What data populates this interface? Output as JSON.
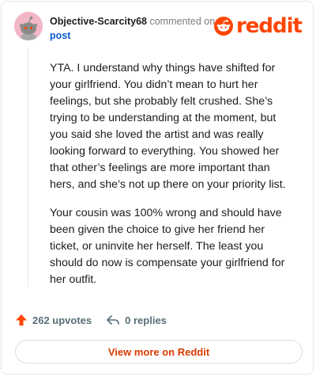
{
  "comment": {
    "username": "Objective-Scarcity68",
    "commented_on": "commented on",
    "post_link": "post",
    "paragraphs": [
      "YTA. I understand why things have shifted for your girlfriend. You didn’t mean to hurt her feelings, but she probably felt crushed. She’s trying to be understanding at the moment, but you said she loved the artist and was really looking forward to everything. You showed her that other’s feelings are more important than hers, and she’s not up there on your priority list.",
      "Your cousin was 100% wrong and should have been given the choice to give her friend her ticket, or uninvite her herself. The least you should do now is compensate your girlfriend for her outfit."
    ],
    "upvotes": "262 upvotes",
    "replies": "0 replies"
  },
  "brand": {
    "logo_text": "reddit",
    "accent_color": "#ff4500",
    "button_text_color": "#d93a00"
  },
  "footer": {
    "view_more_label": "View more on Reddit"
  },
  "icons": {
    "avatar": "snoo-avatar",
    "logo": "reddit-snoo-icon",
    "upvote": "upvote-arrow-icon",
    "reply": "reply-arrow-icon"
  }
}
